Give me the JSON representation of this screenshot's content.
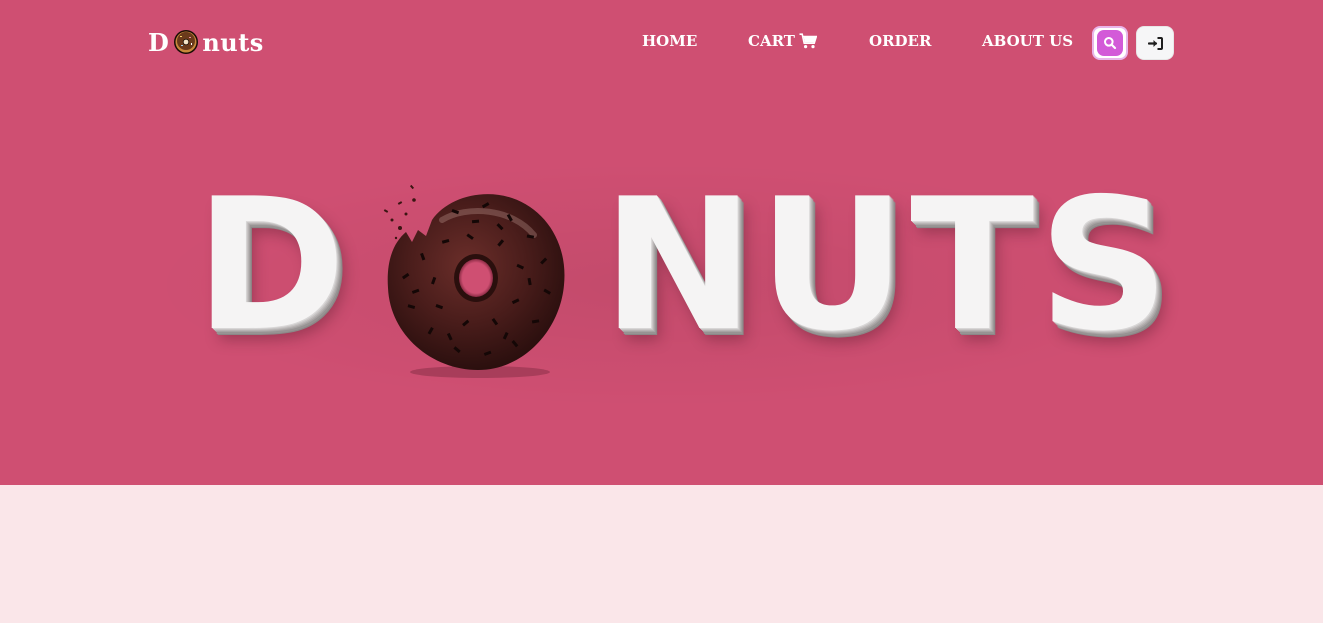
{
  "logo": {
    "prefix": "D",
    "suffix": "nuts",
    "icon": "donut-icon"
  },
  "nav": {
    "items": [
      {
        "label": "HOME"
      },
      {
        "label": "CART",
        "icon": "cart-icon"
      },
      {
        "label": "ORDER"
      },
      {
        "label": "ABOUT US"
      }
    ],
    "search_icon": "search-icon",
    "login_icon": "sign-in-icon"
  },
  "hero": {
    "title_prefix": "D",
    "title_suffix": "NUTS",
    "title_donut": "chocolate-donut-image",
    "background": "#cf4f72"
  },
  "colors": {
    "hero_bg": "#cf4f72",
    "page_bg": "#fae6e9",
    "search_accent": "#d35ad8",
    "nav_text": "#ffffff"
  }
}
